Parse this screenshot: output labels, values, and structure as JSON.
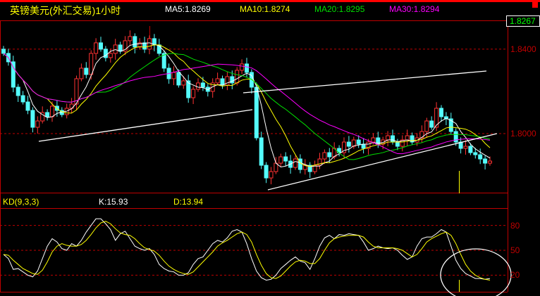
{
  "header": {
    "title": "英镑美元(外汇交易)1小时",
    "ma5": "MA5:1.8269",
    "ma10": "MA10:1.8274",
    "ma20": "MA20:1.8295",
    "ma30": "MA30:1.8294",
    "current_price": "1.8267"
  },
  "colors": {
    "up": "#ff3232",
    "down": "#54fcfc",
    "ma5": "#ffffff",
    "ma10": "#ffff00",
    "ma20": "#00e000",
    "ma30": "#ff00ff",
    "grid": "#c00000",
    "k": "#ffffff",
    "d": "#ffff00"
  },
  "chart_data": [
    {
      "type": "candlestick",
      "title": "英镑美元(外汇交易)1小时",
      "ylim": [
        1.7717,
        1.8533
      ],
      "y_ticks": [
        "1.8400",
        "1.8000"
      ],
      "y_tick_values": [
        1.84,
        1.8
      ],
      "close": [
        1.838,
        1.834,
        1.822,
        1.818,
        1.815,
        1.811,
        1.803,
        1.806,
        1.81,
        1.808,
        1.813,
        1.811,
        1.809,
        1.812,
        1.814,
        1.826,
        1.831,
        1.828,
        1.838,
        1.843,
        1.84,
        1.836,
        1.838,
        1.842,
        1.839,
        1.844,
        1.846,
        1.841,
        1.843,
        1.84,
        1.845,
        1.842,
        1.838,
        1.831,
        1.826,
        1.829,
        1.823,
        1.825,
        1.817,
        1.821,
        1.824,
        1.822,
        1.82,
        1.824,
        1.826,
        1.823,
        1.827,
        1.824,
        1.83,
        1.833,
        1.829,
        1.822,
        1.798,
        1.785,
        1.779,
        1.782,
        1.786,
        1.789,
        1.787,
        1.784,
        1.788,
        1.783,
        1.785,
        1.782,
        1.785,
        1.788,
        1.791,
        1.789,
        1.793,
        1.791,
        1.796,
        1.794,
        1.797,
        1.795,
        1.793,
        1.796,
        1.798,
        1.795,
        1.797,
        1.799,
        1.796,
        1.794,
        1.797,
        1.799,
        1.796,
        1.798,
        1.801,
        1.806,
        1.803,
        1.812,
        1.808,
        1.807,
        1.801,
        1.796,
        1.793,
        1.794,
        1.791,
        1.79,
        1.788,
        1.786,
        1.787
      ],
      "ma_periods": [
        5,
        10,
        20,
        30
      ],
      "legend": [
        "MA5:1.8269",
        "MA10:1.8274",
        "MA20:1.8295",
        "MA30:1.8294"
      ]
    },
    {
      "type": "line",
      "title": "KD(9,3,3)",
      "ylim": [
        0,
        100
      ],
      "y_ticks": [
        "80",
        "50",
        "20"
      ],
      "y_tick_values": [
        80,
        50,
        20
      ],
      "series": [
        {
          "name": "K:15.93",
          "values": [
            45,
            40,
            27,
            28,
            24,
            20,
            18,
            25,
            40,
            55,
            64,
            60,
            52,
            50,
            58,
            55,
            62,
            72,
            80,
            88,
            88,
            82,
            75,
            62,
            70,
            73,
            64,
            55,
            52,
            50,
            52,
            45,
            33,
            28,
            25,
            24,
            20,
            20,
            23,
            33,
            40,
            42,
            50,
            58,
            62,
            60,
            65,
            73,
            75,
            72,
            58,
            40,
            25,
            17,
            14,
            15,
            20,
            28,
            33,
            38,
            42,
            37,
            35,
            27,
            40,
            55,
            65,
            68,
            64,
            69,
            68,
            70,
            69,
            68,
            60,
            50,
            52,
            55,
            53,
            52,
            53,
            50,
            44,
            39,
            42,
            55,
            64,
            66,
            66,
            70,
            75,
            72,
            55,
            38,
            28,
            22,
            19,
            16,
            16,
            15,
            16
          ]
        },
        {
          "name": "D:13.94",
          "values": [
            45,
            44,
            38,
            33,
            28,
            25,
            22,
            21,
            26,
            36,
            48,
            55,
            58,
            56,
            55,
            55,
            57,
            62,
            69,
            77,
            83,
            85,
            82,
            76,
            71,
            69,
            68,
            64,
            58,
            53,
            51,
            49,
            44,
            37,
            31,
            27,
            24,
            22,
            21,
            24,
            30,
            36,
            42,
            48,
            55,
            59,
            62,
            66,
            70,
            72,
            69,
            60,
            45,
            32,
            22,
            17,
            16,
            19,
            25,
            31,
            36,
            38,
            37,
            34,
            34,
            40,
            50,
            59,
            64,
            66,
            67,
            68,
            68,
            68,
            66,
            60,
            55,
            53,
            53,
            53,
            53,
            52,
            50,
            46,
            42,
            45,
            52,
            60,
            64,
            67,
            70,
            72,
            68,
            58,
            45,
            33,
            25,
            20,
            17,
            15,
            14
          ]
        }
      ]
    }
  ]
}
